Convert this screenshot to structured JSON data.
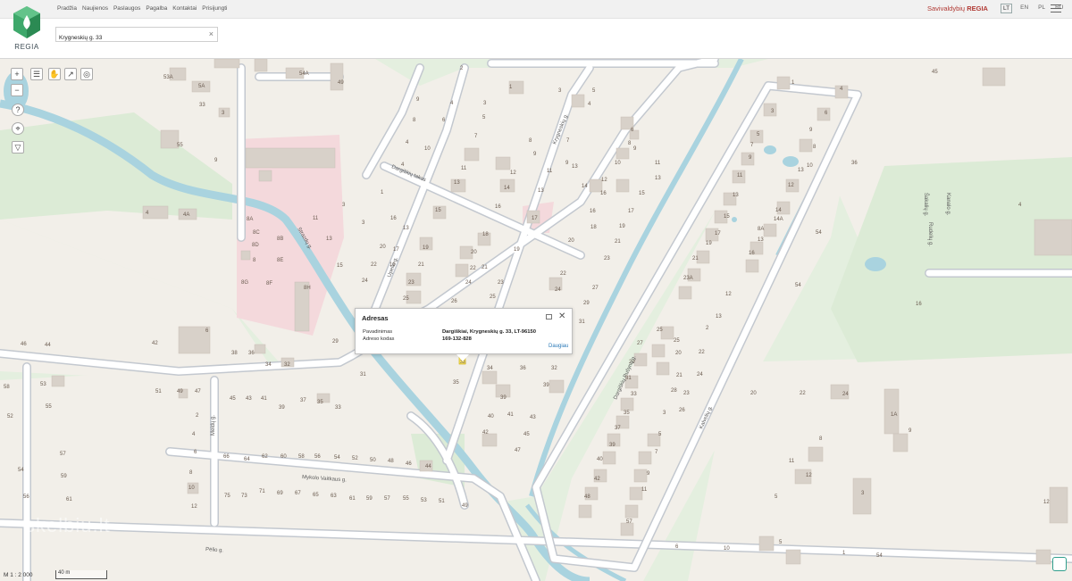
{
  "app": {
    "name": "REGIA"
  },
  "nav": [
    "Pradžia",
    "Naujienos",
    "Paslaugos",
    "Pagalba",
    "Kontaktai",
    "Prisijungti"
  ],
  "brand": {
    "prefix": "Savivaldybių",
    "name": "REGIA"
  },
  "languages": [
    "LT",
    "EN",
    "PL",
    "RU"
  ],
  "active_language": "LT",
  "search": {
    "value": "Krygneskių g. 33"
  },
  "popup": {
    "title": "Adresas",
    "rows": [
      {
        "key": "Pavadinimas",
        "value": "Dargiškiai, Krygneskių g. 33, LT-96150"
      },
      {
        "key": "Adreso kodas",
        "value": "169-132-828"
      }
    ],
    "more_link": "Daugiau"
  },
  "scale": {
    "ratio": "M 1 : 2 000",
    "bar_label": "40 m"
  },
  "watermark": "skelbiu.lt",
  "streets": [
    "Strazdų g.",
    "Krygneskių g.",
    "Upelio g.",
    "Dargiškių takas",
    "Meldų g.",
    "Mykolo Vaitkaus g.",
    "Pėlio g.",
    "Dargiškių Pušynų g.",
    "Kalvelių g.",
    "Šakalių g.",
    "Rudelių g.",
    "Kanalo g."
  ],
  "map_colors": {
    "background": "#e4efdf",
    "residential": "#f2efe9",
    "building": "#d8d1c9",
    "road": "#ffffff",
    "road_edge": "#c3c8cf",
    "water": "#a9d3df",
    "school": "#f4d9dc"
  }
}
